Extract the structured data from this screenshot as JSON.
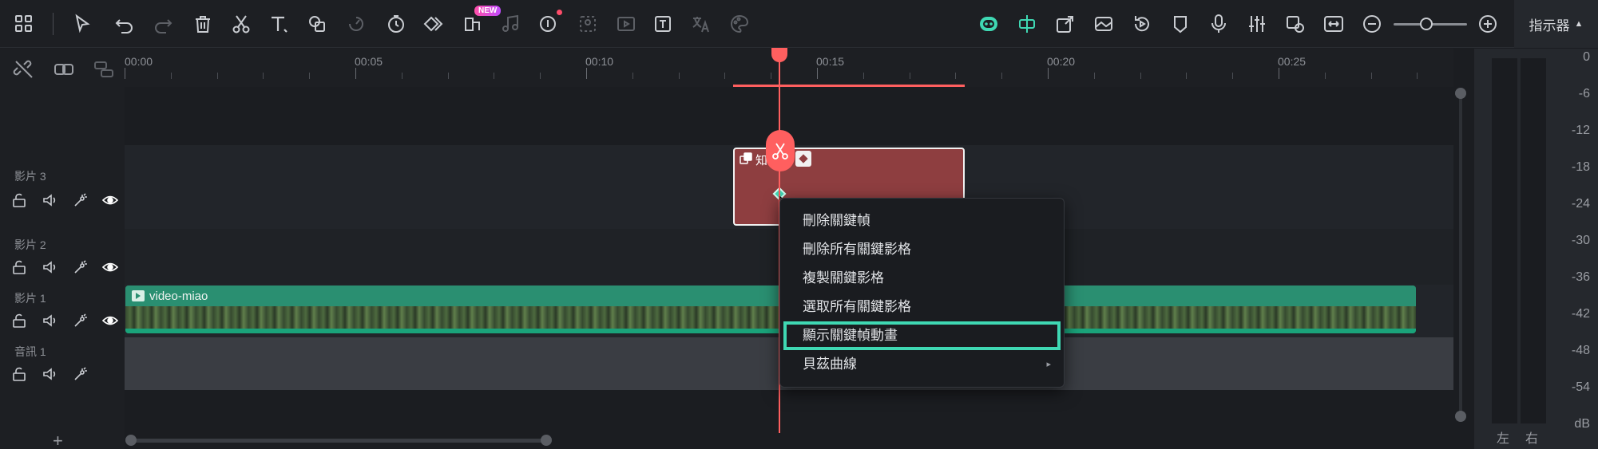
{
  "toolbar": {
    "icons": [
      "grid-icon",
      "select-arrow-icon",
      "undo-icon",
      "redo-icon",
      "delete-icon",
      "cut-icon",
      "text-icon",
      "crop-icon",
      "speed-icon",
      "timer-icon",
      "keyframe-icon",
      "ai-sticker-icon",
      "music-icon",
      "ai-voice-icon",
      "ai-cutout-icon",
      "ai-portrait-icon",
      "ai-text-icon",
      "ai-translate-icon",
      "ai-palette-icon"
    ],
    "new_badge": "NEW",
    "right_icons": [
      "ai-copilot-icon",
      "snap-icon",
      "export-icon",
      "image-icon",
      "replay-icon",
      "marker-icon",
      "microphone-icon",
      "mixer-icon",
      "preview-icon",
      "fit-icon",
      "zoom-out-icon",
      "zoom-in-icon"
    ],
    "zoom_level": 0.45,
    "monitor_label": "指示器",
    "monitor_arrow": "▲"
  },
  "ruler": {
    "labels": [
      "00:00",
      "00:05",
      "00:10",
      "00:15",
      "00:20",
      "00:25"
    ]
  },
  "tracks": [
    {
      "name": "影片 3"
    },
    {
      "name": "影片 2"
    },
    {
      "name": "影片 1"
    },
    {
      "name": "音訊 1"
    }
  ],
  "clips": {
    "video3_label": "知",
    "video1_label": "video-miao"
  },
  "context_menu": {
    "items": [
      {
        "label": "刪除關鍵幀"
      },
      {
        "label": "刪除所有關鍵影格"
      },
      {
        "label": "複製關鍵影格"
      },
      {
        "label": "選取所有關鍵影格"
      },
      {
        "label": "顯示關鍵幀動畫"
      },
      {
        "label": "貝茲曲線",
        "submenu": "▸"
      }
    ]
  },
  "meter": {
    "scale": [
      "0",
      "-6",
      "-12",
      "-18",
      "-24",
      "-30",
      "-36",
      "-42",
      "-48",
      "-54",
      "dB"
    ],
    "left": "左",
    "right": "右"
  },
  "add_track": "+",
  "colors": {
    "accent": "#3fd8b3",
    "playhead": "#ff5f5f",
    "clip_red": "#8e3e40",
    "clip_green": "#1f7a60"
  }
}
